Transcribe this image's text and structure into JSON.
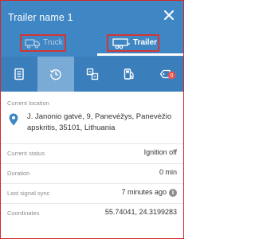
{
  "header": {
    "title": "Trailer name 1",
    "segments": [
      {
        "label": "Truck",
        "icon": "truck-icon",
        "selected": false
      },
      {
        "label": "Trailer",
        "icon": "trailer-icon",
        "selected": true
      }
    ]
  },
  "tabs": [
    {
      "icon": "document-icon",
      "active": false
    },
    {
      "icon": "history-icon",
      "active": true
    },
    {
      "icon": "swap-icon",
      "active": false
    },
    {
      "icon": "fuel-icon",
      "active": false
    },
    {
      "icon": "notification-tag-icon",
      "active": false,
      "badge": "0"
    }
  ],
  "details": {
    "location_label": "Current location",
    "address": "J. Janonio gatvė, 9, Panevėžys, Panevėžio apskritis, 35101, Lithuania",
    "rows": [
      {
        "label": "Current status",
        "value": "Ignition off"
      },
      {
        "label": "Duration",
        "value": "0 min"
      },
      {
        "label": "Last signal sync",
        "value": "7 minutes ago",
        "info": "i"
      },
      {
        "label": "Coordinates",
        "value": "55.74041, 24.3199283"
      }
    ]
  },
  "colors": {
    "header": "#3e86c4",
    "tab_bar": "#3a7fbc",
    "active_tab": "#7aaad6",
    "highlight_border": "#d43535",
    "badge": "#e05252"
  }
}
